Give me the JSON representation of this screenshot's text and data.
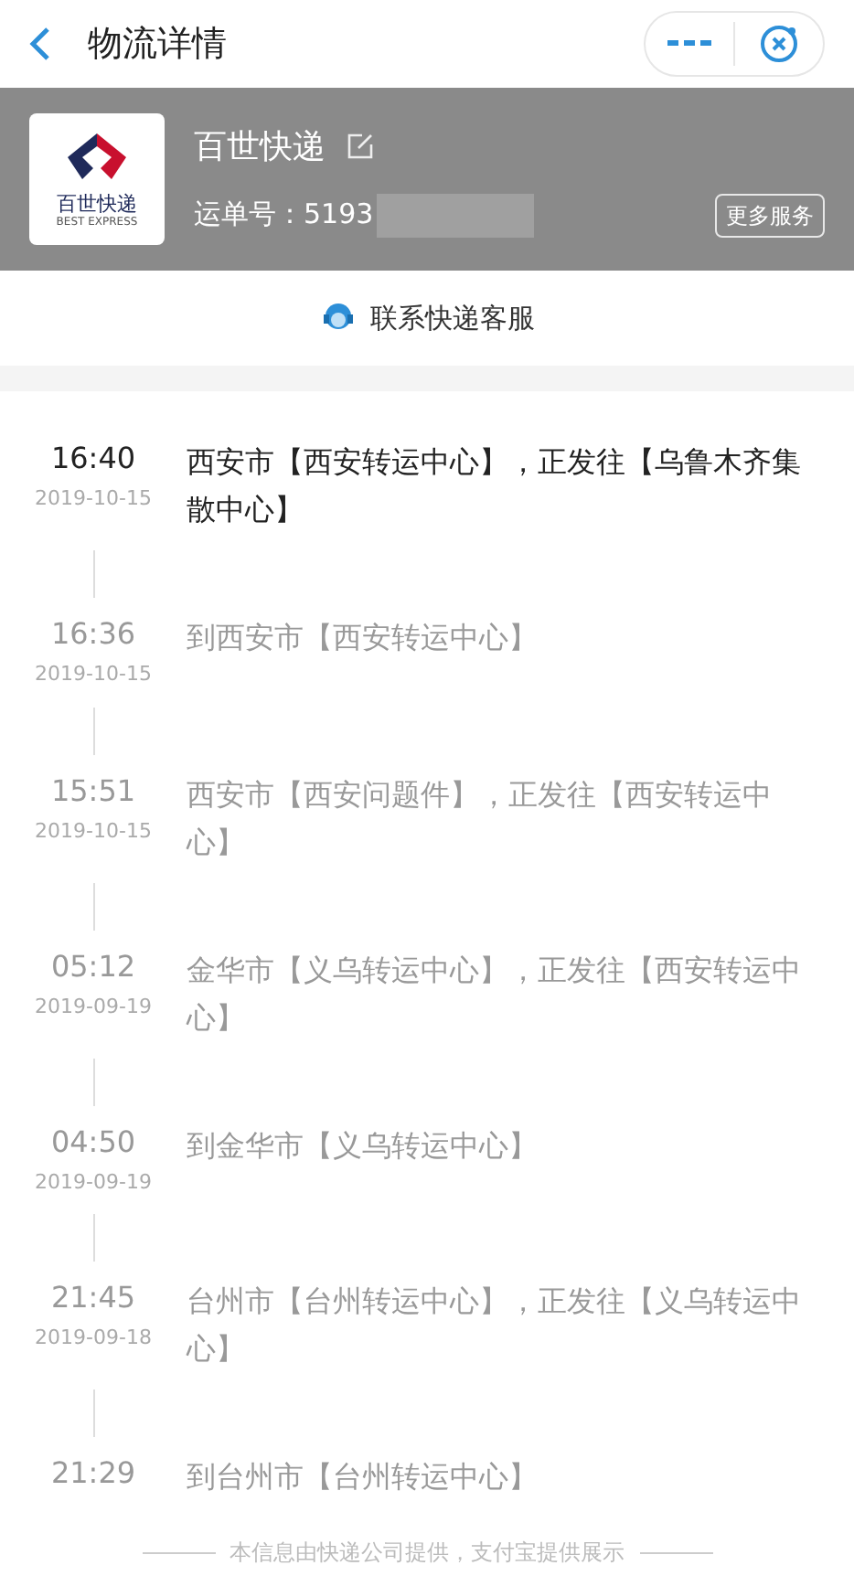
{
  "nav": {
    "title": "物流详情"
  },
  "company": {
    "name": "百世快递",
    "logo_text": "百世快递",
    "logo_subtext": "BEST EXPRESS",
    "waybill_label": "运单号：",
    "waybill_number": "5193",
    "more_button": "更多服务"
  },
  "contact": {
    "label": "联系快递客服"
  },
  "events": [
    {
      "time": "16:40",
      "date": "2019-10-15",
      "text": "西安市【西安转运中心】，正发往【乌鲁木齐集散中心】",
      "current": true
    },
    {
      "time": "16:36",
      "date": "2019-10-15",
      "text": "到西安市【西安转运中心】",
      "current": false
    },
    {
      "time": "15:51",
      "date": "2019-10-15",
      "text": "西安市【西安问题件】，正发往【西安转运中心】",
      "current": false
    },
    {
      "time": "05:12",
      "date": "2019-09-19",
      "text": "金华市【义乌转运中心】，正发往【西安转运中心】",
      "current": false
    },
    {
      "time": "04:50",
      "date": "2019-09-19",
      "text": "到金华市【义乌转运中心】",
      "current": false
    },
    {
      "time": "21:45",
      "date": "2019-09-18",
      "text": "台州市【台州转运中心】，正发往【义乌转运中心】",
      "current": false
    },
    {
      "time": "21:29",
      "text": "到台州市【台州转运中心】",
      "current": false
    }
  ],
  "footer": "本信息由快递公司提供，支付宝提供展示"
}
